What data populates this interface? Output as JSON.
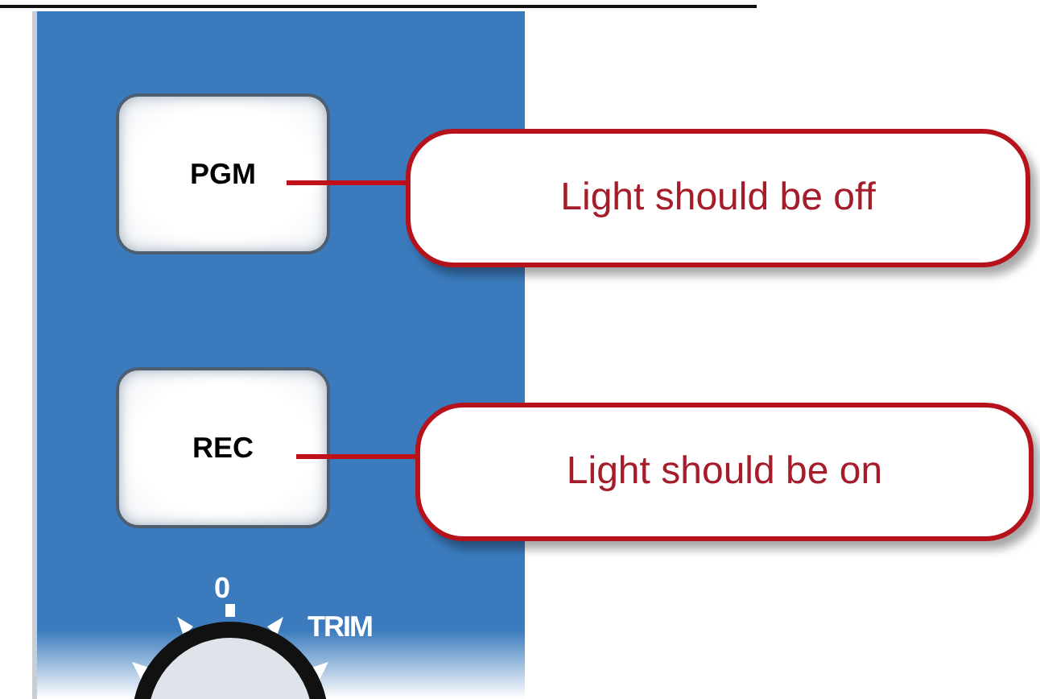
{
  "panel": {
    "buttons": [
      {
        "label": "PGM"
      },
      {
        "label": "REC"
      }
    ],
    "trim_knob": {
      "scale_label": "0",
      "label": "TRIM"
    }
  },
  "callouts": [
    {
      "text": "Light should be off"
    },
    {
      "text": "Light should be on"
    }
  ]
}
